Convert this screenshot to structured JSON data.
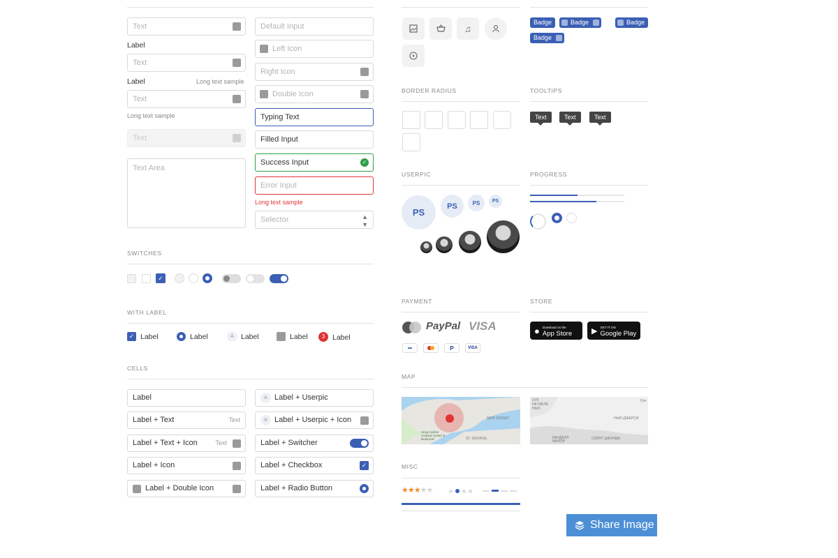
{
  "inputs": {
    "text1": "Text",
    "label1": "Label",
    "text2": "Text",
    "label2": "Label",
    "long_text_right": "Long text sample",
    "text3": "Text",
    "long_text_below": "Long text sample",
    "text_disabled": "Text",
    "textarea": "Text Area",
    "default_input": "Default Input",
    "left_icon": "Left Icon",
    "right_icon": "Right Icon",
    "double_icon": "Double Icon",
    "typing_text": "Typing Text",
    "filled_input": "Filled Input",
    "success_input": "Success Input",
    "error_input": "Error Input",
    "error_text": "Long text sample",
    "selector": "Selector"
  },
  "sections": {
    "switches": "SWITCHES",
    "with_label": "WITH LABEL",
    "cells": "CELLS",
    "border_radius": "BORDER RADIUS",
    "tooltips": "TOOLTIPS",
    "userpic": "USERPIC",
    "progress": "PROGRESS",
    "payment": "PAYMENT",
    "store": "STORE",
    "map": "MAP",
    "misc": "MISC"
  },
  "with_label": [
    "Label",
    "Label",
    "Label",
    "Label",
    "Label"
  ],
  "with_label_count": "3",
  "cells_left": [
    "Label",
    "Label + Text",
    "Label + Text + Icon",
    "Label + Icon",
    "Label + Double Icon"
  ],
  "cells_left_extra": [
    "Text",
    "Text"
  ],
  "cells_right": [
    "Label + Userpic",
    "Label + Userpic + Icon",
    "Label + Switcher",
    "Label + Checkbox",
    "Label + Radio Button"
  ],
  "badges": [
    "Badge",
    "Badge",
    "Badge",
    "Badge"
  ],
  "tooltips": [
    "Text",
    "Text",
    "Text"
  ],
  "userpic_initials": [
    "PS",
    "PS",
    "PS",
    "PS"
  ],
  "payment": {
    "paypal": "PayPal",
    "visa": "VISA",
    "mini_visa": "VISA"
  },
  "store": {
    "app_small": "Download on the",
    "app_big": "App Store",
    "play_small": "GET IT ON",
    "play_big": "Google Play"
  },
  "map": {
    "left_labels": [
      "NEW JERSEY",
      "Snug Harbor Cultural Center & Botanical",
      "ST. GEORGE"
    ],
    "right_labels": [
      "XУК НЕТАБЛЕ НЬЮ",
      "Оге",
      "НЬЮ-ДЖЕРСИ",
      "РАНДАЛЛ МАНОР",
      "СЕЙНТ ДЖОРДЖ"
    ]
  },
  "misc": {
    "rating": 3,
    "rating_max": 5
  },
  "progress": {
    "bar1": 0.5,
    "bar2": 0.7
  },
  "share_button": "Share Image",
  "colors": {
    "accent": "#3b5fb4",
    "success": "#2e9e4a",
    "error": "#e03535",
    "share": "#4c8fd6"
  }
}
